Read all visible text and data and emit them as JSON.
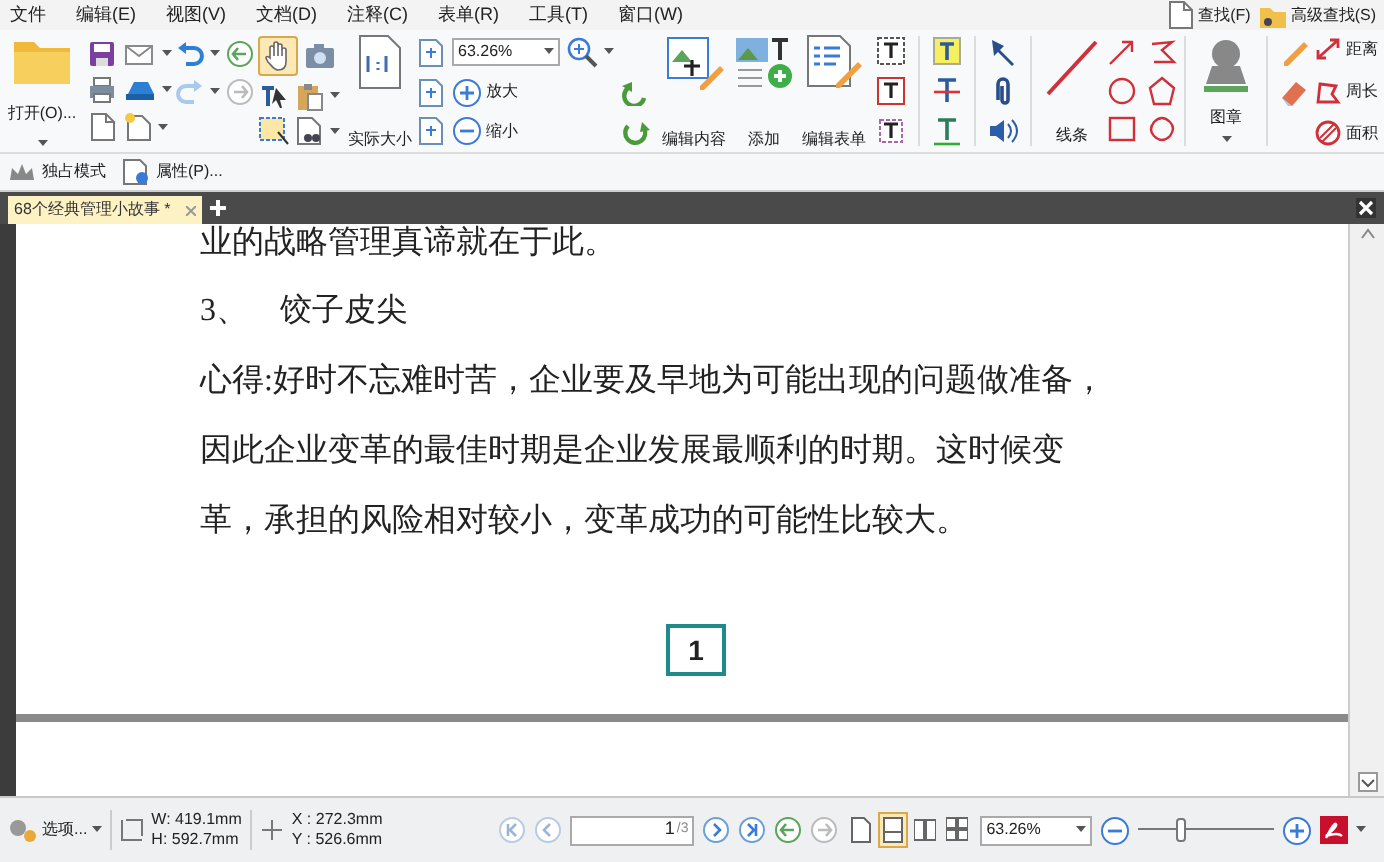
{
  "menu": [
    {
      "label": "文件"
    },
    {
      "label": "编辑(E)"
    },
    {
      "label": "视图(V)"
    },
    {
      "label": "文档(D)"
    },
    {
      "label": "注释(C)"
    },
    {
      "label": "表单(R)"
    },
    {
      "label": "工具(T)"
    },
    {
      "label": "窗口(W)"
    }
  ],
  "search_links": [
    {
      "label": "查找(F)"
    },
    {
      "label": "高级查找(S)"
    }
  ],
  "toolbar": {
    "open": "打开(O)...",
    "hand_tool": {
      "selected": true
    },
    "actual_size": "实际大小",
    "zoom_value": "63.26%",
    "zoom_in": "放大",
    "zoom_out": "缩小",
    "edit_content": "编辑内容",
    "add": "添加",
    "edit_form": "编辑表单",
    "lines": "线条",
    "stamp": "图章",
    "measure": [
      {
        "label": "距离"
      },
      {
        "label": "周长"
      },
      {
        "label": "面积"
      }
    ]
  },
  "toolbar2": [
    {
      "label": "独占模式"
    },
    {
      "label": "属性(P)..."
    }
  ],
  "tabs": [
    {
      "label": "68个经典管理小故事 *",
      "selected": true
    }
  ],
  "document": {
    "lines": [
      "业的战略管理真谛就在于此。",
      "3、    饺子皮尖",
      "心得:好时不忘难时苦，企业要及早地为可能出现的问题做准备，",
      "因此企业变革的最佳时期是企业发展最顺利的时期。这时候变",
      "革，承担的风险相对较小，变革成功的可能性比较大。"
    ],
    "page_number": "1"
  },
  "status_bar": {
    "options": "选项...",
    "width": "W: 419.1mm",
    "height": "H: 592.7mm",
    "x": "X : 272.3mm",
    "y": "Y : 526.6mm",
    "page_input": "1",
    "page_total": "/3",
    "zoom": "63.26%",
    "zoom_slider": {
      "level": 0.31
    },
    "layout_modes": [
      {
        "selected": false
      },
      {
        "selected": true
      },
      {
        "selected": false
      },
      {
        "selected": false
      }
    ]
  }
}
